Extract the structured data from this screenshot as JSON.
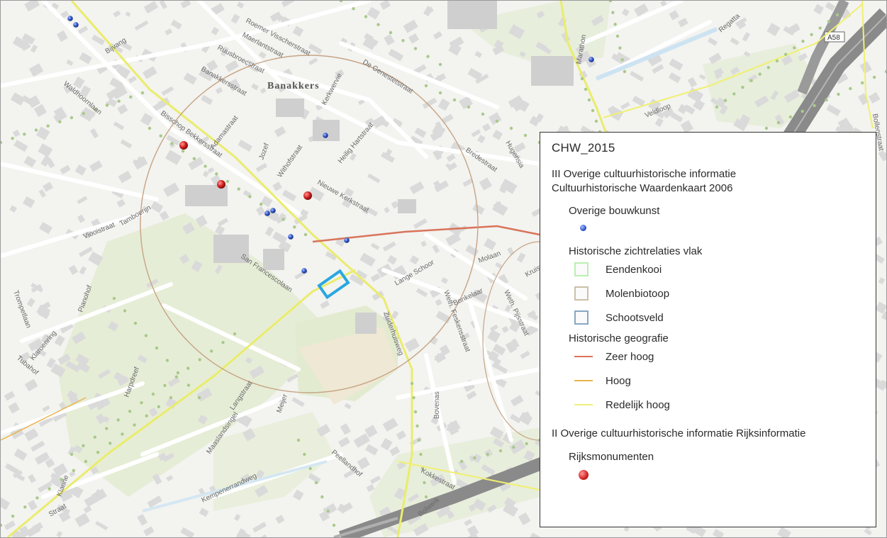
{
  "map": {
    "district_label": "Banakkers",
    "road_shield": "A58",
    "street_labels": [
      "Bijvang",
      "Waldhoornlaan",
      "Roemer Visscherstraat",
      "Maerlantstraat",
      "Ruusbroecstraat",
      "Banakkersstraat",
      "De Genestetstraat",
      "Kerkwervie",
      "Heilig Hartstraat",
      "Bisschop Bekkersstraat",
      "Adamastraat",
      "Withofstraat",
      "Nieuwe Kerkstraat",
      "Jozef",
      "Bredestraat",
      "Viooistraat",
      "Tamboerijn",
      "San Francescolaan",
      "Lange Schoor",
      "Bonkelaar",
      "Trompetlaan",
      "Pianohof",
      "Klaroenring",
      "Tubahof",
      "Harpdreef",
      "Zuiderhuisweg",
      "Langstraat",
      "Maaslandsingel",
      "Meijer",
      "Peellandhof",
      "Kempenerrandweg",
      "Bovenas",
      "Kokkestraat",
      "Bolwerk",
      "Veldloop",
      "Regatta",
      "Marathon",
      "Hugensia",
      "Molaan",
      "Kruisvaart",
      "Weth. Feskensstraat",
      "Weth. Pijsstraat",
      "Bollenstraat",
      "Klarine",
      "Straat"
    ]
  },
  "legend": {
    "title": "CHW_2015",
    "group1_line1": "III Overige cultuurhistorische informatie",
    "group1_line2": "Cultuurhistorische Waardenkaart 2006",
    "sub1_label": "Overige bouwkunst",
    "sub2_label": "Historische zichtrelaties vlak",
    "sub2_items": [
      {
        "label": "Eendenkooi",
        "color": "#b9f0b0"
      },
      {
        "label": "Molenbiotoop",
        "color": "#cdbfa8"
      },
      {
        "label": "Schootsveld",
        "color": "#87a7c5"
      }
    ],
    "sub3_label": "Historische geografie",
    "sub3_items": [
      {
        "label": "Zeer hoog",
        "color": "#d9745a"
      },
      {
        "label": "Hoog",
        "color": "#e9b44a"
      },
      {
        "label": "Redelijk hoog",
        "color": "#eef07a"
      }
    ],
    "group2": "II Overige cultuurhistorische informatie Rijksinformatie",
    "sub4_label": "Rijksmonumenten"
  },
  "colors": {
    "background": "#f3f3f0",
    "building": "#dadada",
    "park": "#e4ecd4",
    "highway": "#8a8a8a",
    "overige_bouwkunst": "#2f53c7",
    "rijksmonument": "#d2221f",
    "selection": "#2aa7e0"
  }
}
